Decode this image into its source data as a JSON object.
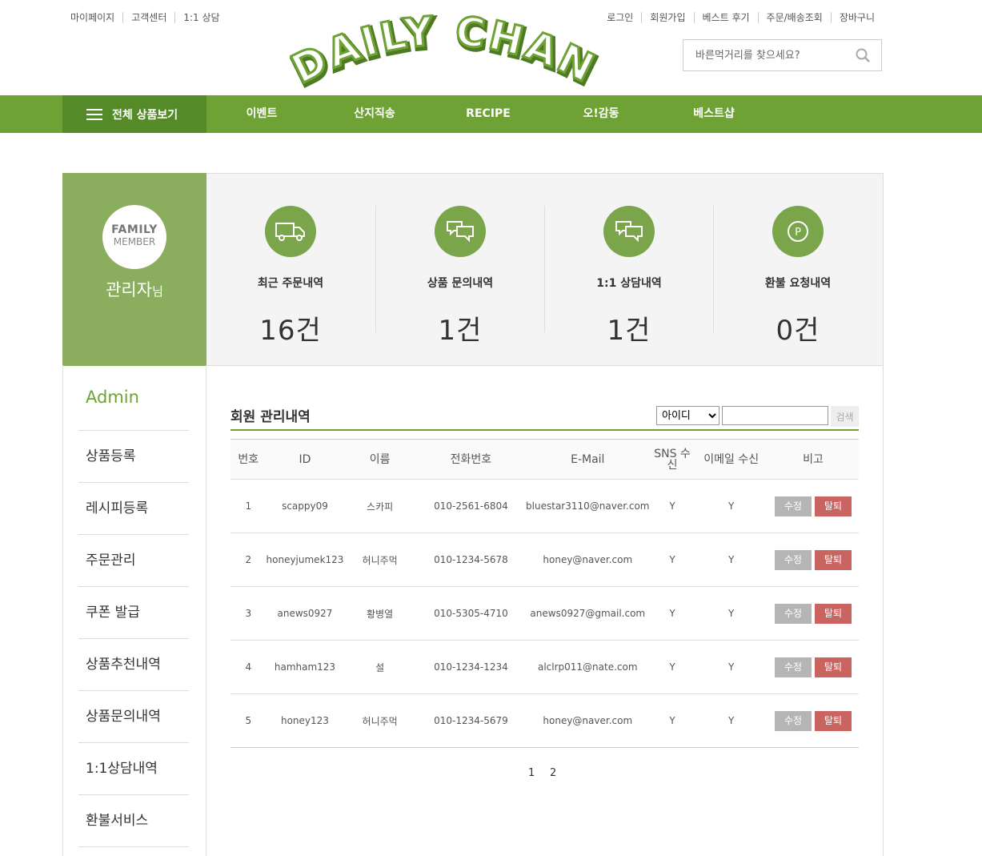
{
  "util_left": [
    "마이페이지",
    "고객센터",
    "1:1 상담"
  ],
  "util_right": [
    "로그인",
    "회원가입",
    "베스트 후기",
    "주문/배송조회",
    "장바구니"
  ],
  "logo_text": "DAILY CHAN",
  "search": {
    "placeholder": "바른먹거리를 찾으세요?"
  },
  "nav": {
    "all_label": "전체 상품보기",
    "items": [
      "이벤트",
      "산지직송",
      "RECIPE",
      "오!감동",
      "베스트샵"
    ]
  },
  "member": {
    "badge_line1": "FAMILY",
    "badge_line2": "MEMBER",
    "name": "관리자",
    "suffix": "님"
  },
  "stats": [
    {
      "label": "최근 주문내역",
      "count": "16건",
      "icon": "truck-icon"
    },
    {
      "label": "상품 문의내역",
      "count": "1건",
      "icon": "chat-bubbles-icon"
    },
    {
      "label": "1:1 상담내역",
      "count": "1건",
      "icon": "chat-bubbles-icon"
    },
    {
      "label": "환불 요청내역",
      "count": "0건",
      "icon": "point-coin-icon"
    }
  ],
  "sidebar": {
    "title": "Admin",
    "items": [
      "상품등록",
      "레시피등록",
      "주문관리",
      "쿠폰 발급",
      "상품추천내역",
      "상품문의내역",
      "1:1상담내역",
      "환불서비스"
    ]
  },
  "member_list": {
    "title": "회원 관리내역",
    "filter_selected": "아이디",
    "search_button": "검색",
    "headers": [
      "번호",
      "ID",
      "이름",
      "전화번호",
      "E-Mail",
      "SNS 수신",
      "이메일 수신",
      "비고"
    ],
    "edit_label": "수정",
    "delete_label": "탈퇴",
    "rows": [
      {
        "no": "1",
        "id": "scappy09",
        "name": "스카피",
        "phone": "010-2561-6804",
        "email": "bluestar3110@naver.com",
        "sns": "Y",
        "mail": "Y"
      },
      {
        "no": "2",
        "id": "honeyjumek123",
        "name": "허니주먹",
        "phone": "010-1234-5678",
        "email": "honey@naver.com",
        "sns": "Y",
        "mail": "Y"
      },
      {
        "no": "3",
        "id": "anews0927",
        "name": "황병열",
        "phone": "010-5305-4710",
        "email": "anews0927@gmail.com",
        "sns": "Y",
        "mail": "Y"
      },
      {
        "no": "4",
        "id": "hamham123",
        "name": "설",
        "phone": "010-1234-1234",
        "email": "alclrp011@nate.com",
        "sns": "Y",
        "mail": "Y"
      },
      {
        "no": "5",
        "id": "honey123",
        "name": "허니주먹",
        "phone": "010-1234-5679",
        "email": "honey@naver.com",
        "sns": "Y",
        "mail": "Y"
      }
    ]
  },
  "pagination": [
    "1",
    "2"
  ],
  "colors": {
    "brand_green": "#6ea234",
    "dark_green": "#548a28",
    "member_green": "#8aad5e",
    "delete_red": "#c96460",
    "edit_gray": "#b5b5b5"
  }
}
